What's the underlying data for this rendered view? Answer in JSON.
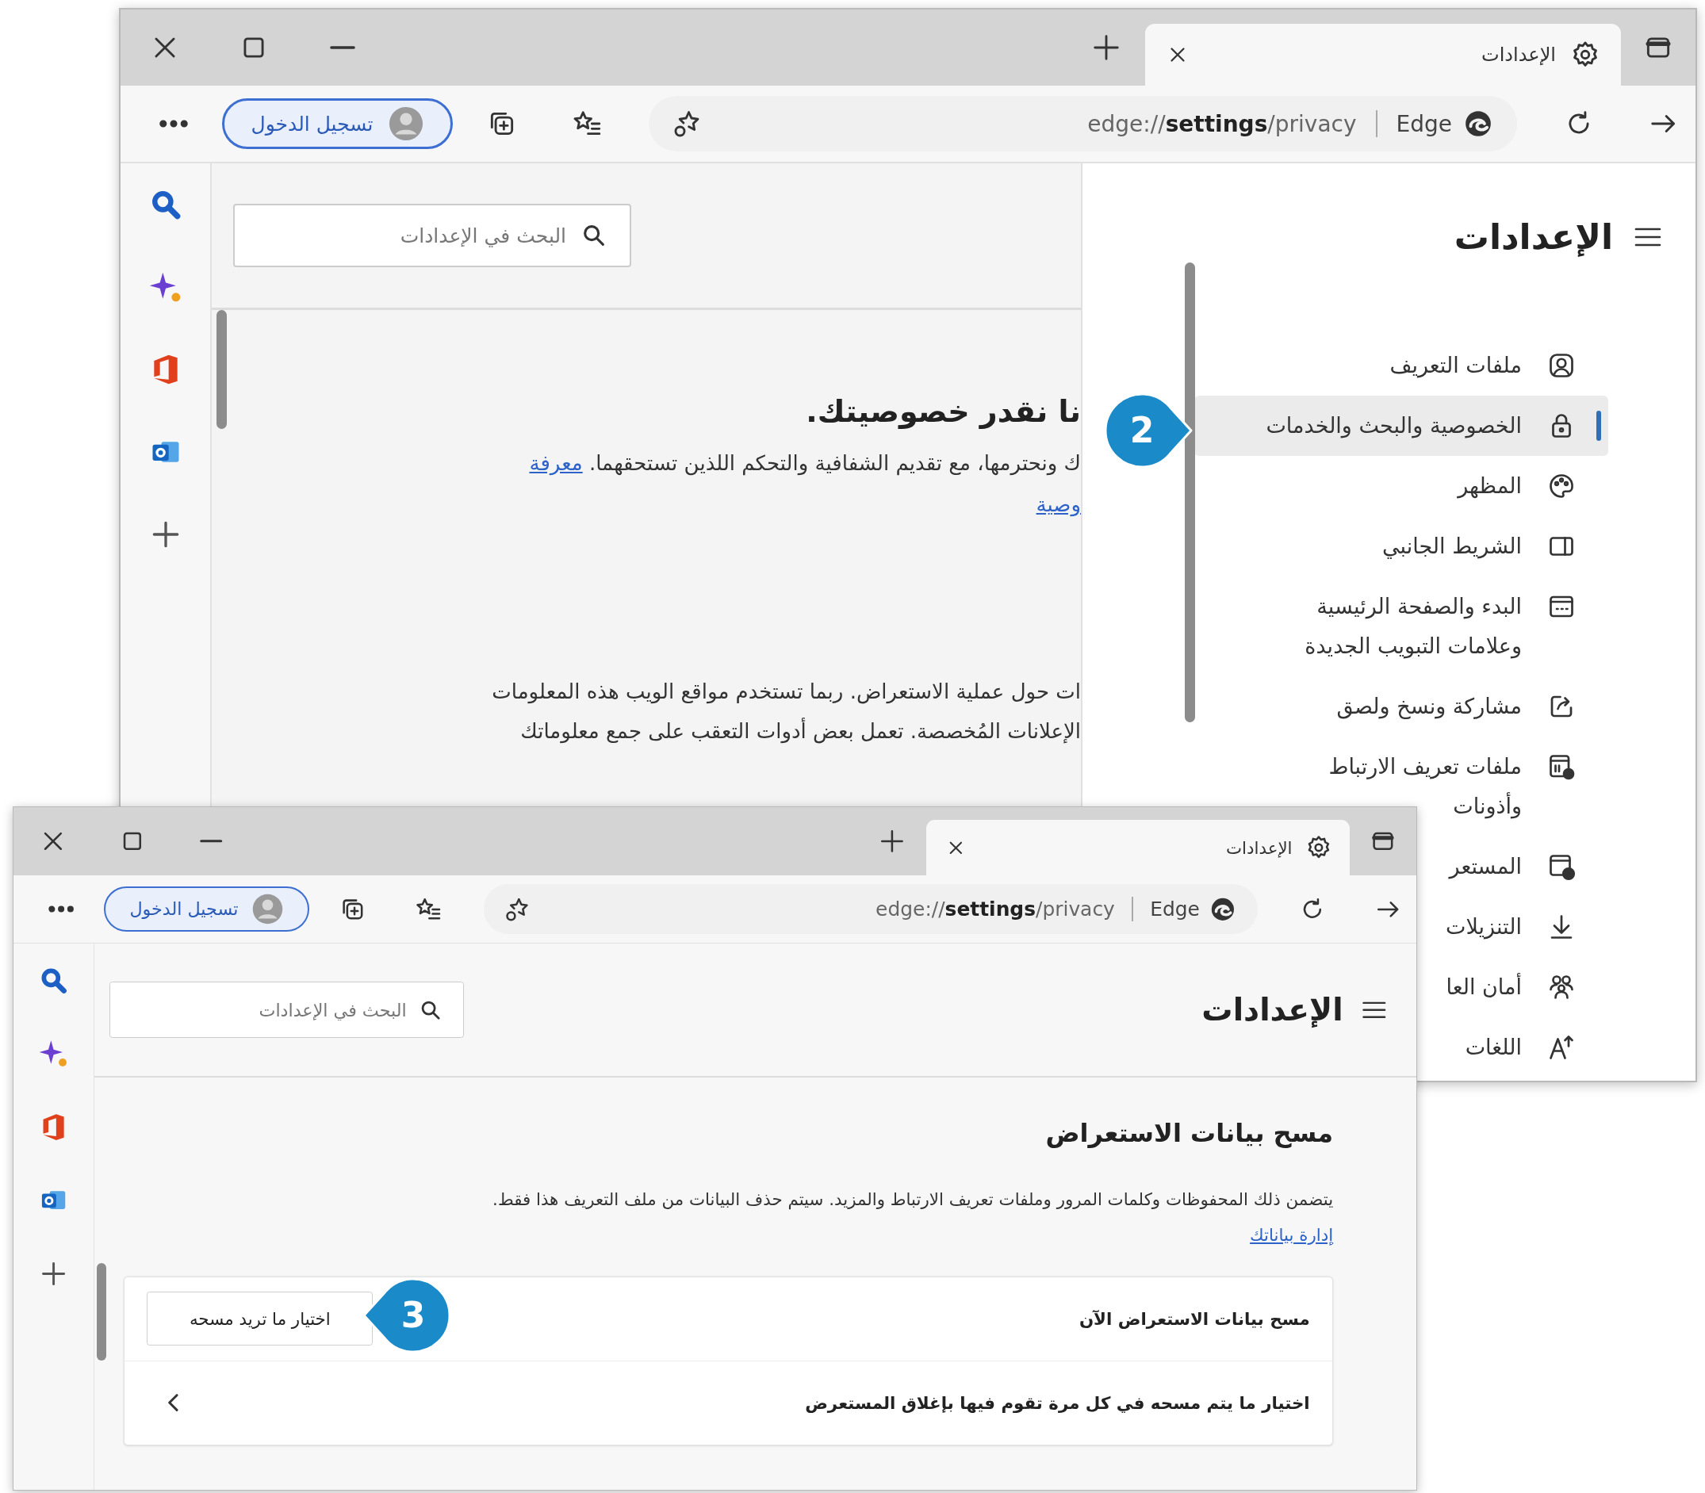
{
  "windows": [
    {
      "tab": {
        "title": "الإعدادات"
      },
      "address": {
        "brand": "Edge",
        "url": "edge://**settings**/privacy"
      },
      "sign_in": "تسجيل الدخول",
      "settings_title": "الإعدادات",
      "search": {
        "placeholder": "البحث في الإعدادات"
      },
      "content": {
        "heading": "نا نقدر خصوصيتك.",
        "intro": {
          "text": "ك ونحترمها، مع تقديم الشفافية والتحكم اللذين تستحقهما.",
          "link": "معرفة",
          "link_line2": "وصية"
        },
        "lines": [
          "ات حول عملية الاستعراض. ربما تستخدم مواقع الويب هذه المعلومات",
          "الإعلانات المُخصصة. تعمل بعض أدوات التعقب على جمع معلوماتك"
        ]
      },
      "nav": {
        "items": [
          {
            "lines": [
              "ملفات التعريف"
            ],
            "selected": false
          },
          {
            "lines": [
              "الخصوصية والبحث والخدمات"
            ],
            "selected": true
          },
          {
            "lines": [
              "المظهر"
            ],
            "selected": false
          },
          {
            "lines": [
              "الشريط الجانبي"
            ],
            "selected": false
          },
          {
            "lines": [
              "البدء والصفحة الرئيسية",
              "وعلامات التبويب الجديدة"
            ],
            "selected": false
          },
          {
            "lines": [
              "مشاركة ونسخ ولصق"
            ],
            "selected": false
          },
          {
            "lines": [
              "ملفات تعريف الارتباط",
              "وأذونات"
            ],
            "selected": false
          },
          {
            "lines": [
              "المستعر"
            ],
            "selected": false
          },
          {
            "lines": [
              "التنزيلات"
            ],
            "selected": false
          },
          {
            "lines": [
              "أمان العا"
            ],
            "selected": false
          },
          {
            "lines": [
              "اللغات"
            ],
            "selected": false
          }
        ]
      }
    },
    {
      "tab": {
        "title": "الإعدادات"
      },
      "address": {
        "brand": "Edge",
        "url": "edge://**settings**/privacy"
      },
      "sign_in": "تسجيل الدخول",
      "settings_title": "الإعدادات",
      "search": {
        "placeholder": "البحث في الإعدادات"
      },
      "section": {
        "heading": "مسح بيانات الاستعراض",
        "description": "يتضمن ذلك المحفوظات وكلمات المرور وملفات تعريف الارتباط والمزيد. سيتم حذف البيانات من ملف التعريف هذا فقط.",
        "link": "إدارة بياناتك",
        "rows": [
          {
            "kind": "button",
            "label": "مسح بيانات الاستعراض الآن",
            "button": "اختيار ما تريد مسحه"
          },
          {
            "kind": "chevron",
            "label": "اختيار ما يتم مسحه في كل مرة تقوم فيها بإغلاق المستعرض"
          }
        ]
      }
    }
  ],
  "callouts": [
    {
      "number": "2"
    },
    {
      "number": "3"
    }
  ]
}
